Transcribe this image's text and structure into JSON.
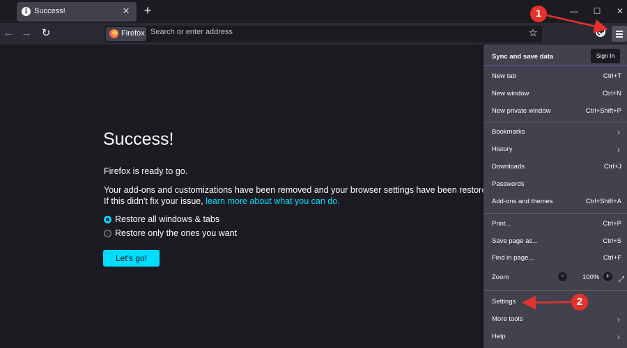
{
  "tab": {
    "title": "Success!",
    "close": "✕"
  },
  "newtab_label": "+",
  "window": {
    "minimize": "—",
    "maximize": "☐",
    "close": "✕"
  },
  "nav": {
    "back": "←",
    "forward": "→",
    "reload": "↻"
  },
  "urlbar": {
    "identity_label": "Firefox",
    "placeholder": "Search or enter address",
    "bookmark_icon": "☆"
  },
  "page": {
    "heading": "Success!",
    "ready": "Firefox is ready to go.",
    "desc_line1": "Your add-ons and customizations have been removed and your browser settings have been restored to the",
    "desc_line2_prefix": "If this didn't fix your issue, ",
    "desc_link": "learn more about what you can do.",
    "radio_all": "Restore all windows & tabs",
    "radio_some": "Restore only the ones you want",
    "go_button": "Let's go!"
  },
  "menu": {
    "sync_title": "Sync and save data",
    "signin": "Sign In",
    "items": [
      {
        "label": "New tab",
        "shortcut": "Ctrl+T"
      },
      {
        "label": "New window",
        "shortcut": "Ctrl+N"
      },
      {
        "label": "New private window",
        "shortcut": "Ctrl+Shift+P"
      },
      {
        "label": "Bookmarks",
        "shortcut": ""
      },
      {
        "label": "History",
        "shortcut": ""
      },
      {
        "label": "Downloads",
        "shortcut": "Ctrl+J"
      },
      {
        "label": "Passwords",
        "shortcut": ""
      },
      {
        "label": "Add-ons and themes",
        "shortcut": "Ctrl+Shift+A"
      },
      {
        "label": "Print...",
        "shortcut": "Ctrl+P"
      },
      {
        "label": "Save page as...",
        "shortcut": "Ctrl+S"
      },
      {
        "label": "Find in page...",
        "shortcut": "Ctrl+F"
      },
      {
        "label": "Zoom",
        "shortcut": ""
      },
      {
        "label": "Settings",
        "shortcut": ""
      },
      {
        "label": "More tools",
        "shortcut": ""
      },
      {
        "label": "Help",
        "shortcut": ""
      }
    ],
    "zoom": {
      "minus": "−",
      "value": "100%",
      "plus": "+"
    }
  },
  "annotations": {
    "one": "1",
    "two": "2"
  },
  "colors": {
    "accent": "#00ddff",
    "annotation": "#e5322d",
    "background": "#1c1b22",
    "panel": "#42414d"
  }
}
